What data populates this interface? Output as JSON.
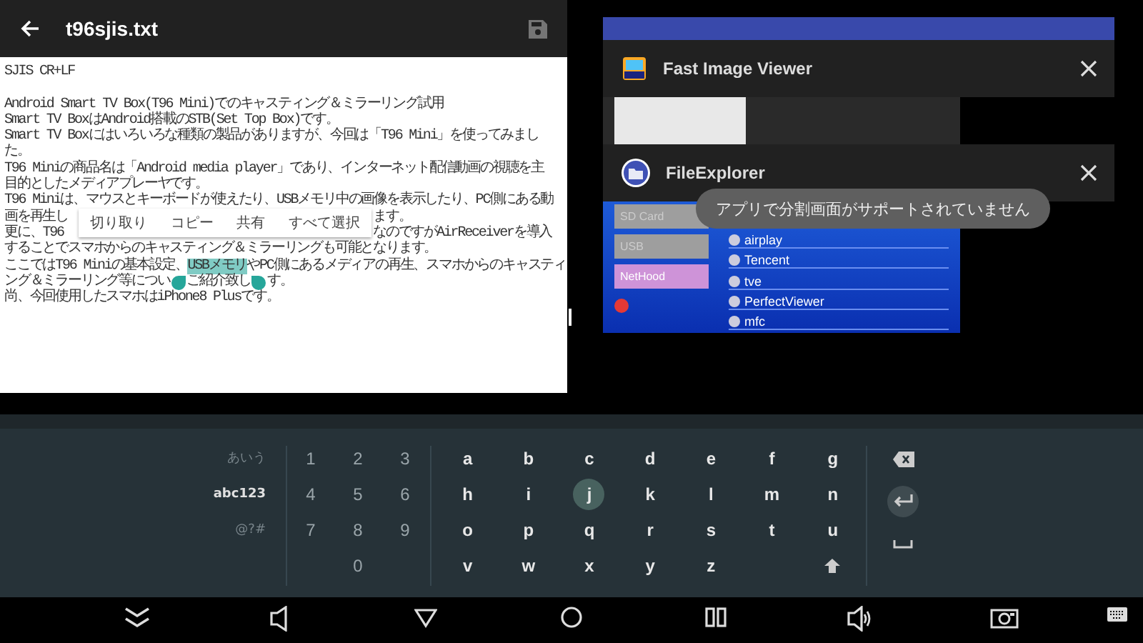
{
  "editor": {
    "title": "t96sjis.txt",
    "lines": [
      {
        "kind": "text",
        "text": "SJIS CR+LF"
      },
      {
        "kind": "blank"
      },
      {
        "kind": "text",
        "text": "Android Smart TV Box(T96 Mini)でのキャスティング＆ミラーリング試用"
      },
      {
        "kind": "text",
        "text": "Smart TV BoxはAndroid搭載のSTB(Set Top Box)です。"
      },
      {
        "kind": "text",
        "text": "Smart TV Boxにはいろいろな種類の製品がありますが、今回は「T96 Mini」を使ってみまし"
      },
      {
        "kind": "text",
        "text": "た。"
      },
      {
        "kind": "text",
        "text": "T96 Miniの商品名は「Android media player」であり、インターネット配信動画の視聴を主"
      },
      {
        "kind": "text",
        "text": "目的としたメディアプレーヤです。"
      },
      {
        "kind": "text",
        "text": "T96 Miniは、マウスとキーボードが使えたり、USBメモリ中の画像を表示したり、PC側にある動"
      },
      {
        "kind": "split",
        "left": "画を再生し",
        "right": "ます。"
      },
      {
        "kind": "split",
        "left": "更に、T96",
        "right": "なのですがAirReceiverを導入"
      },
      {
        "kind": "text",
        "text": "することでスマホからのキャスティング＆ミラーリングも可能となります。"
      },
      {
        "kind": "selection",
        "before": "ここではT96 Miniの基本設定、",
        "selected": "USBメモリ",
        "after": "やPC側にあるメディアの再生、スマホからのキャスティ"
      },
      {
        "kind": "handles",
        "parts": [
          "ング＆ミラーリング等につい",
          "ご紹介致し",
          "す。"
        ]
      },
      {
        "kind": "text",
        "text": "尚、今回使用したスマホはiPhone8 Plusです。"
      }
    ],
    "context_menu": [
      "切り取り",
      "コピー",
      "共有",
      "すべて選択"
    ]
  },
  "recents": {
    "cards": [
      {
        "kind": "partial"
      },
      {
        "kind": "thumbnail",
        "title": "Fast Image Viewer"
      },
      {
        "kind": "explorer",
        "title": "FileExplorer",
        "sidebar": [
          "SD Card",
          "USB",
          "NetHood"
        ],
        "files": [
          "airplay",
          "Tencent",
          "tve",
          "PerfectViewer",
          "mfc"
        ]
      }
    ],
    "toast": "アプリで分割画面がサポートされていません"
  },
  "keyboard": {
    "modes": [
      {
        "label": "あいう",
        "selected": false
      },
      {
        "label": "abc123",
        "selected": true
      },
      {
        "label": "@?#",
        "selected": false
      }
    ],
    "digits": [
      "1",
      "2",
      "3",
      "4",
      "5",
      "6",
      "7",
      "8",
      "9",
      "0"
    ],
    "letters": [
      {
        "label": "a",
        "focused": false
      },
      {
        "label": "b",
        "focused": false
      },
      {
        "label": "c",
        "focused": false
      },
      {
        "label": "d",
        "focused": false
      },
      {
        "label": "e",
        "focused": false
      },
      {
        "label": "f",
        "focused": false
      },
      {
        "label": "g",
        "focused": false
      },
      {
        "label": "h",
        "focused": false
      },
      {
        "label": "i",
        "focused": false
      },
      {
        "label": "j",
        "focused": true
      },
      {
        "label": "k",
        "focused": false
      },
      {
        "label": "l",
        "focused": false
      },
      {
        "label": "m",
        "focused": false
      },
      {
        "label": "n",
        "focused": false
      },
      {
        "label": "o",
        "focused": false
      },
      {
        "label": "p",
        "focused": false
      },
      {
        "label": "q",
        "focused": false
      },
      {
        "label": "r",
        "focused": false
      },
      {
        "label": "s",
        "focused": false
      },
      {
        "label": "t",
        "focused": false
      },
      {
        "label": "u",
        "focused": false
      },
      {
        "label": "v",
        "focused": false
      },
      {
        "label": "w",
        "focused": false
      },
      {
        "label": "x",
        "focused": false
      },
      {
        "label": "y",
        "focused": false
      },
      {
        "label": "z",
        "focused": false
      }
    ]
  }
}
